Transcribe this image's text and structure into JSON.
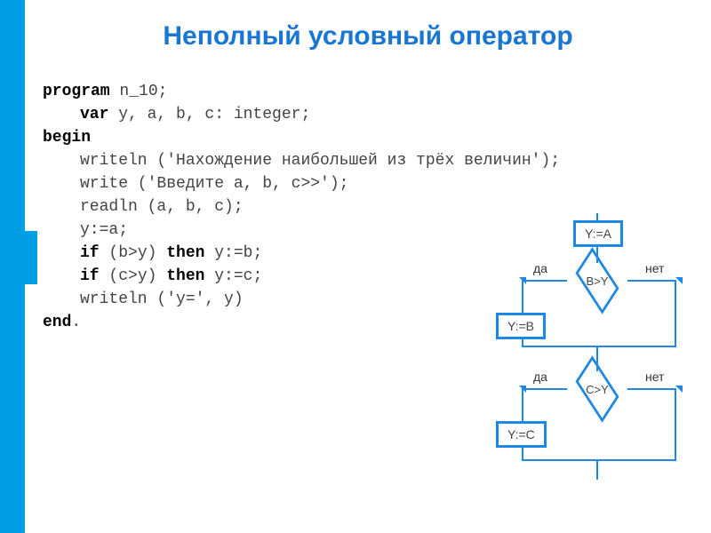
{
  "title": "Неполный условный оператор",
  "code": {
    "l1_kw": "program",
    "l1_txt": " n_10;",
    "l2_kw": "var",
    "l2_txt": " y, a, b, c: integer;",
    "l3_kw": "begin",
    "l4": "writeln ('Нахождение наибольшей из трёх величин');",
    "l5": "write ('Введите a, b, c>>');",
    "l6": "readln (a, b, c);",
    "l7": "y:=a;",
    "l8_kw1": "if",
    "l8_txt1": " (b>y) ",
    "l8_kw2": "then",
    "l8_txt2": " y:=b;",
    "l9_kw1": "if",
    "l9_txt1": " (c>y) ",
    "l9_kw2": "then",
    "l9_txt2": " y:=c;",
    "l10": "writeln ('y=', y)",
    "l11_kw": "end",
    "l11_txt": "."
  },
  "flowchart": {
    "box_ya": "Y:=A",
    "box_yb": "Y:=B",
    "box_yc": "Y:=C",
    "cond_by": "B>Y",
    "cond_cy": "C>Y",
    "yes": "да",
    "no": "нет"
  }
}
